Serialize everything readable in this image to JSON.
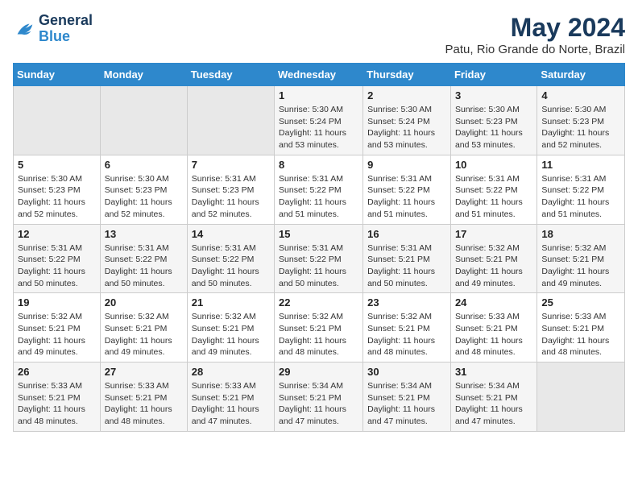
{
  "logo": {
    "line1": "General",
    "line2": "Blue"
  },
  "title": "May 2024",
  "location": "Patu, Rio Grande do Norte, Brazil",
  "days_of_week": [
    "Sunday",
    "Monday",
    "Tuesday",
    "Wednesday",
    "Thursday",
    "Friday",
    "Saturday"
  ],
  "weeks": [
    [
      {
        "day": "",
        "content": ""
      },
      {
        "day": "",
        "content": ""
      },
      {
        "day": "",
        "content": ""
      },
      {
        "day": "1",
        "content": "Sunrise: 5:30 AM\nSunset: 5:24 PM\nDaylight: 11 hours\nand 53 minutes."
      },
      {
        "day": "2",
        "content": "Sunrise: 5:30 AM\nSunset: 5:24 PM\nDaylight: 11 hours\nand 53 minutes."
      },
      {
        "day": "3",
        "content": "Sunrise: 5:30 AM\nSunset: 5:23 PM\nDaylight: 11 hours\nand 53 minutes."
      },
      {
        "day": "4",
        "content": "Sunrise: 5:30 AM\nSunset: 5:23 PM\nDaylight: 11 hours\nand 52 minutes."
      }
    ],
    [
      {
        "day": "5",
        "content": "Sunrise: 5:30 AM\nSunset: 5:23 PM\nDaylight: 11 hours\nand 52 minutes."
      },
      {
        "day": "6",
        "content": "Sunrise: 5:30 AM\nSunset: 5:23 PM\nDaylight: 11 hours\nand 52 minutes."
      },
      {
        "day": "7",
        "content": "Sunrise: 5:31 AM\nSunset: 5:23 PM\nDaylight: 11 hours\nand 52 minutes."
      },
      {
        "day": "8",
        "content": "Sunrise: 5:31 AM\nSunset: 5:22 PM\nDaylight: 11 hours\nand 51 minutes."
      },
      {
        "day": "9",
        "content": "Sunrise: 5:31 AM\nSunset: 5:22 PM\nDaylight: 11 hours\nand 51 minutes."
      },
      {
        "day": "10",
        "content": "Sunrise: 5:31 AM\nSunset: 5:22 PM\nDaylight: 11 hours\nand 51 minutes."
      },
      {
        "day": "11",
        "content": "Sunrise: 5:31 AM\nSunset: 5:22 PM\nDaylight: 11 hours\nand 51 minutes."
      }
    ],
    [
      {
        "day": "12",
        "content": "Sunrise: 5:31 AM\nSunset: 5:22 PM\nDaylight: 11 hours\nand 50 minutes."
      },
      {
        "day": "13",
        "content": "Sunrise: 5:31 AM\nSunset: 5:22 PM\nDaylight: 11 hours\nand 50 minutes."
      },
      {
        "day": "14",
        "content": "Sunrise: 5:31 AM\nSunset: 5:22 PM\nDaylight: 11 hours\nand 50 minutes."
      },
      {
        "day": "15",
        "content": "Sunrise: 5:31 AM\nSunset: 5:22 PM\nDaylight: 11 hours\nand 50 minutes."
      },
      {
        "day": "16",
        "content": "Sunrise: 5:31 AM\nSunset: 5:21 PM\nDaylight: 11 hours\nand 50 minutes."
      },
      {
        "day": "17",
        "content": "Sunrise: 5:32 AM\nSunset: 5:21 PM\nDaylight: 11 hours\nand 49 minutes."
      },
      {
        "day": "18",
        "content": "Sunrise: 5:32 AM\nSunset: 5:21 PM\nDaylight: 11 hours\nand 49 minutes."
      }
    ],
    [
      {
        "day": "19",
        "content": "Sunrise: 5:32 AM\nSunset: 5:21 PM\nDaylight: 11 hours\nand 49 minutes."
      },
      {
        "day": "20",
        "content": "Sunrise: 5:32 AM\nSunset: 5:21 PM\nDaylight: 11 hours\nand 49 minutes."
      },
      {
        "day": "21",
        "content": "Sunrise: 5:32 AM\nSunset: 5:21 PM\nDaylight: 11 hours\nand 49 minutes."
      },
      {
        "day": "22",
        "content": "Sunrise: 5:32 AM\nSunset: 5:21 PM\nDaylight: 11 hours\nand 48 minutes."
      },
      {
        "day": "23",
        "content": "Sunrise: 5:32 AM\nSunset: 5:21 PM\nDaylight: 11 hours\nand 48 minutes."
      },
      {
        "day": "24",
        "content": "Sunrise: 5:33 AM\nSunset: 5:21 PM\nDaylight: 11 hours\nand 48 minutes."
      },
      {
        "day": "25",
        "content": "Sunrise: 5:33 AM\nSunset: 5:21 PM\nDaylight: 11 hours\nand 48 minutes."
      }
    ],
    [
      {
        "day": "26",
        "content": "Sunrise: 5:33 AM\nSunset: 5:21 PM\nDaylight: 11 hours\nand 48 minutes."
      },
      {
        "day": "27",
        "content": "Sunrise: 5:33 AM\nSunset: 5:21 PM\nDaylight: 11 hours\nand 48 minutes."
      },
      {
        "day": "28",
        "content": "Sunrise: 5:33 AM\nSunset: 5:21 PM\nDaylight: 11 hours\nand 47 minutes."
      },
      {
        "day": "29",
        "content": "Sunrise: 5:34 AM\nSunset: 5:21 PM\nDaylight: 11 hours\nand 47 minutes."
      },
      {
        "day": "30",
        "content": "Sunrise: 5:34 AM\nSunset: 5:21 PM\nDaylight: 11 hours\nand 47 minutes."
      },
      {
        "day": "31",
        "content": "Sunrise: 5:34 AM\nSunset: 5:21 PM\nDaylight: 11 hours\nand 47 minutes."
      },
      {
        "day": "",
        "content": ""
      }
    ]
  ]
}
